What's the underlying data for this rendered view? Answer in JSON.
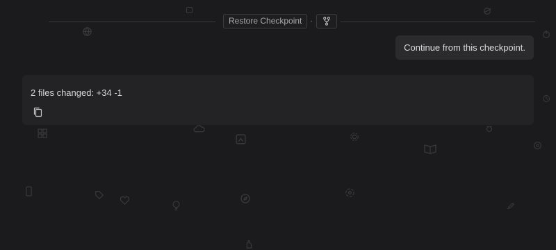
{
  "checkpoint": {
    "restore_label": "Restore Checkpoint",
    "separator": "·",
    "fork_icon": "git-fork-icon"
  },
  "message": {
    "text": "Continue from this checkpoint."
  },
  "changes": {
    "summary": "2 files changed: +34 -1",
    "copy_icon": "copy-icon"
  },
  "colors": {
    "background": "#1b1b1d",
    "card": "#232326",
    "bubble": "#2b2b2e",
    "border": "#3c3c40"
  }
}
